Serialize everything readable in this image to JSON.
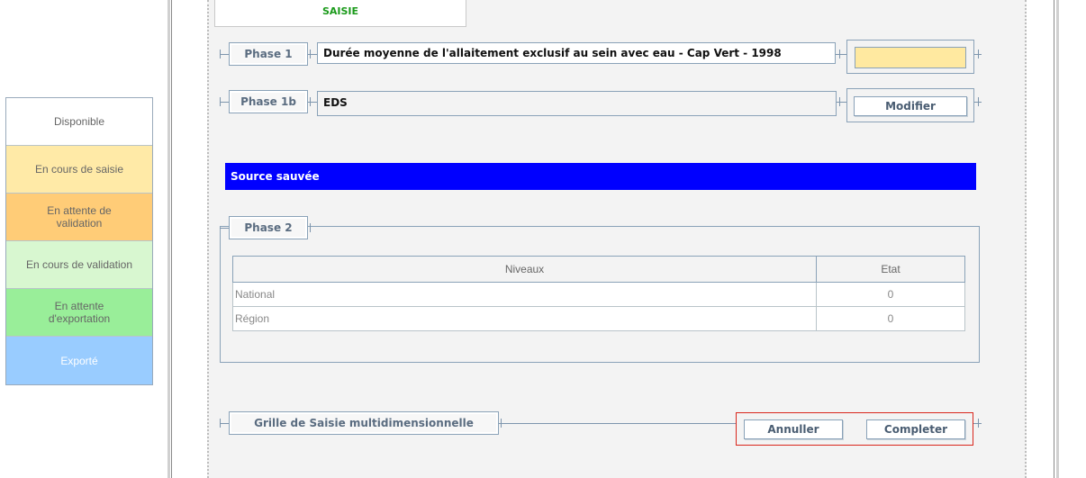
{
  "legend": [
    {
      "label": "Disponible",
      "color": "#ffffff"
    },
    {
      "label": "En cours de saisie",
      "color": "#ffeaa7"
    },
    {
      "label": "En attente de validation",
      "color": "#ffcc77"
    },
    {
      "label": "En cours de validation",
      "color": "#d8f7d0"
    },
    {
      "label": "En attente d'exportation",
      "color": "#99ee99"
    },
    {
      "label": "Exporté",
      "color": "#99ccff"
    }
  ],
  "tab": {
    "label": "SAISIE"
  },
  "phase1": {
    "label": "Phase 1",
    "title": "Durée moyenne de l'allaitement exclusif au sein avec eau - Cap Vert - 1998",
    "field_value": ""
  },
  "phase1b": {
    "label": "Phase 1b",
    "source": "EDS",
    "modify_label": "Modifier"
  },
  "banner": {
    "text": "Source sauvée",
    "color": "#0000ff"
  },
  "phase2": {
    "label": "Phase 2",
    "columns": [
      "Niveaux",
      "Etat"
    ],
    "rows": [
      {
        "niveau": "National",
        "etat": "0"
      },
      {
        "niveau": "Région",
        "etat": "0"
      }
    ]
  },
  "grid": {
    "label": "Grille de Saisie multidimensionnelle",
    "cancel_label": "Annuller",
    "complete_label": "Completer"
  }
}
